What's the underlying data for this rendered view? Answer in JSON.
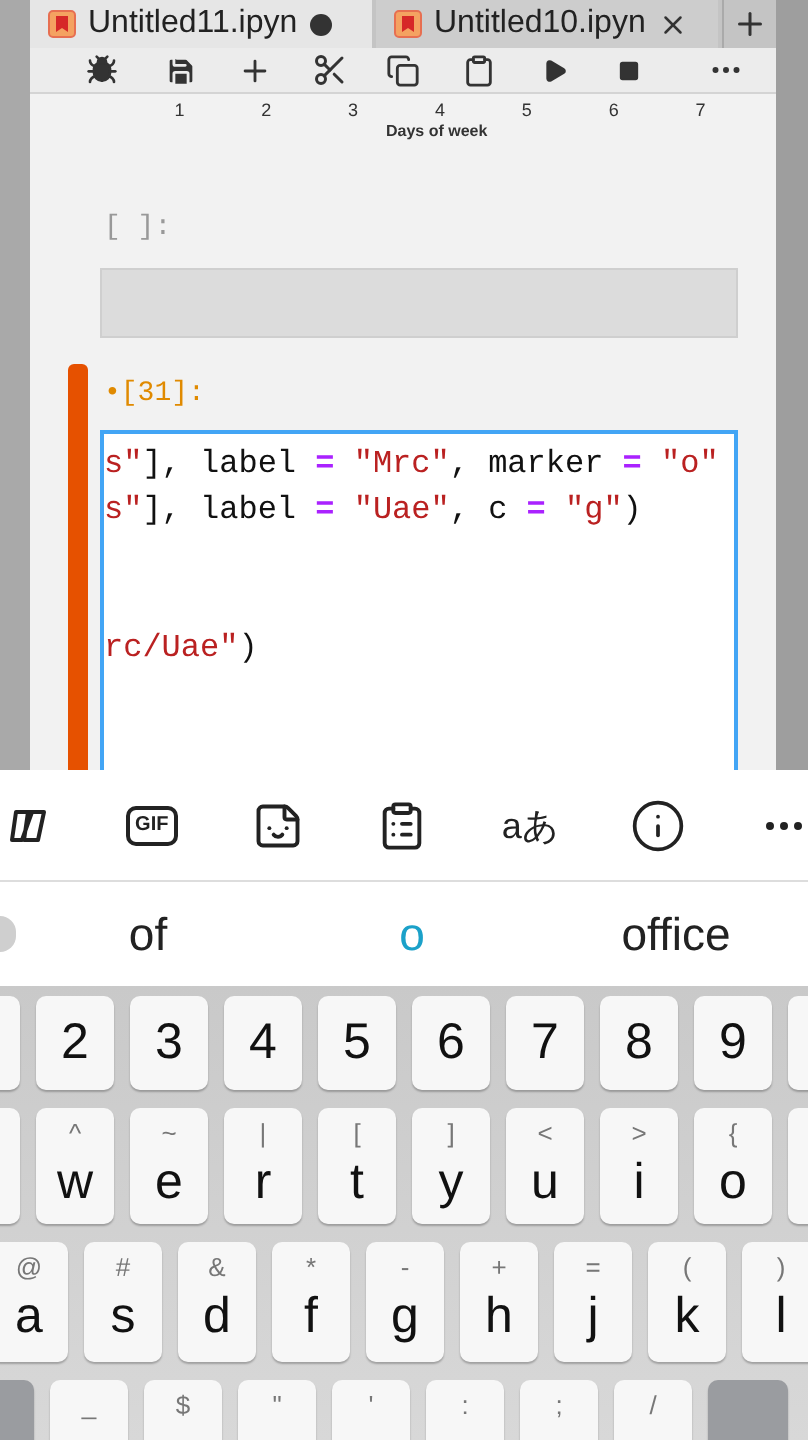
{
  "tabs": [
    {
      "title": "Untitled11.ipyn",
      "selected": true,
      "modified": true
    },
    {
      "title": "Untitled10.ipyn",
      "selected": false,
      "modified": false
    }
  ],
  "plot_axis": {
    "ticks": [
      "1",
      "2",
      "3",
      "4",
      "5",
      "6",
      "7"
    ],
    "xlabel": "Days of week"
  },
  "cells": [
    {
      "kind": "empty",
      "prompt": "[ ]:",
      "selected": false
    },
    {
      "kind": "code",
      "prompt": "•[31]:",
      "selected": true,
      "lines": [
        "s\"], label = \"Mrc\", marker = \"o\"",
        "s\"], label = \"Uae\", c = \"g\")",
        "rc/Uae\")"
      ]
    }
  ],
  "keyboard_toolbar": [
    {
      "kind": "copilot"
    },
    {
      "kind": "gif",
      "label": "GIF"
    },
    {
      "kind": "sticker"
    },
    {
      "kind": "clipboard"
    },
    {
      "kind": "translate",
      "label": "aあ"
    },
    {
      "kind": "info"
    },
    {
      "kind": "more"
    }
  ],
  "suggestions": [
    {
      "text": "of",
      "selected": false
    },
    {
      "text": "o",
      "selected": true
    },
    {
      "text": "office",
      "selected": false
    }
  ],
  "keyboard": {
    "rows": [
      {
        "keys": [
          {
            "label": "2"
          },
          {
            "label": "3"
          },
          {
            "label": "4"
          },
          {
            "label": "5"
          },
          {
            "label": "6"
          },
          {
            "label": "7"
          },
          {
            "label": "8"
          },
          {
            "label": "9"
          }
        ]
      },
      {
        "keys": [
          {
            "label": "w",
            "hint": "^"
          },
          {
            "label": "e",
            "hint": "~"
          },
          {
            "label": "r",
            "hint": "|"
          },
          {
            "label": "t",
            "hint": "["
          },
          {
            "label": "y",
            "hint": "]"
          },
          {
            "label": "u",
            "hint": "<"
          },
          {
            "label": "i",
            "hint": ">"
          },
          {
            "label": "o",
            "hint": "{"
          }
        ]
      },
      {
        "keys": [
          {
            "label": "a",
            "hint": "@"
          },
          {
            "label": "s",
            "hint": "#"
          },
          {
            "label": "d",
            "hint": "&"
          },
          {
            "label": "f",
            "hint": "*"
          },
          {
            "label": "g",
            "hint": "-"
          },
          {
            "label": "h",
            "hint": "+"
          },
          {
            "label": "j",
            "hint": "="
          },
          {
            "label": "k",
            "hint": "("
          },
          {
            "label": "l",
            "hint": ")"
          }
        ]
      },
      {
        "keys": [
          {
            "hint": "_"
          },
          {
            "hint": "$"
          },
          {
            "hint": "\""
          },
          {
            "hint": "'"
          },
          {
            "hint": ":"
          },
          {
            "hint": ";"
          },
          {
            "hint": "/"
          }
        ]
      }
    ]
  }
}
